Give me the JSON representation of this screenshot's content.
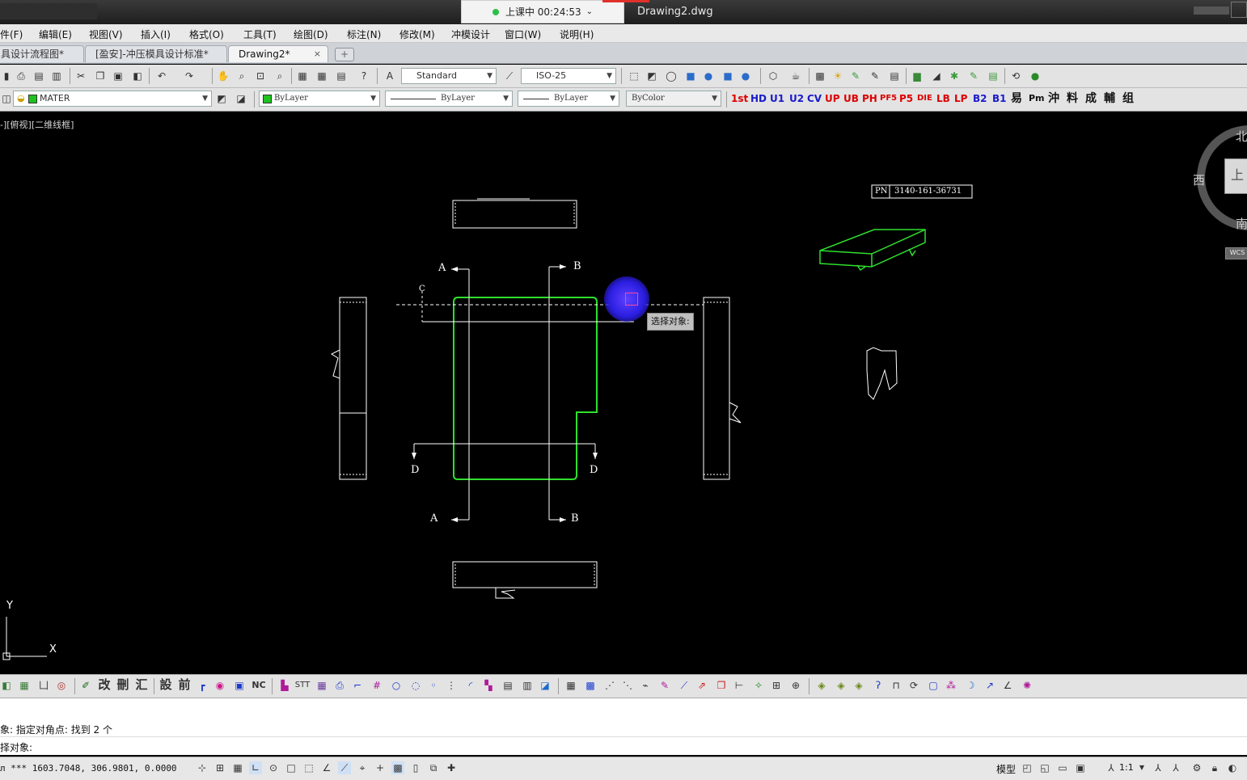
{
  "window": {
    "live_status": "上课中 00:24:53",
    "document_title": "Drawing2.dwg"
  },
  "menu": [
    "件(F)",
    "编辑(E)",
    "视图(V)",
    "插入(I)",
    "格式(O)",
    "工具(T)",
    "绘图(D)",
    "标注(N)",
    "修改(M)",
    "冲模设计",
    "窗口(W)",
    "说明(H)"
  ],
  "tabs": [
    {
      "label": "具设计流程图*"
    },
    {
      "label": "[盈安]-冲压模具设计标准*"
    },
    {
      "label": "Drawing2*",
      "close": "×"
    }
  ],
  "toolbar": {
    "text_style": "Standard",
    "dim_style": "ISO-25",
    "layer": "MATER",
    "color": "ByLayer",
    "linetype": "ByLayer",
    "lineweight": "ByLayer",
    "plot_style": "ByColor",
    "custom_tools": [
      "1st",
      "HD",
      "U1",
      "U2",
      "CV",
      "UP",
      "UB",
      "PH",
      "PF5",
      "P5",
      "DIE",
      "LB",
      "LP",
      "B2",
      "B1",
      "易",
      "Pm",
      "沖",
      "料",
      "成",
      "輔",
      "组"
    ],
    "bottom_text_tools": [
      "改",
      "刪",
      "汇",
      "設",
      "前",
      "NC",
      "STT"
    ]
  },
  "viewport": {
    "label": "-][俯视][二维线框]",
    "viewcube": {
      "north": "北",
      "west": "西",
      "south": "南",
      "top": "上",
      "wcs": "WCS"
    },
    "tooltip": "选择对象:",
    "part_number_label": "PN",
    "part_number": "3140-161-36731",
    "section_labels": {
      "a": "A",
      "b": "B",
      "c": "C",
      "d": "D"
    },
    "ucs_x": "X",
    "ucs_y": "Y"
  },
  "command": {
    "history": "象: 指定对角点: 找到 2 个",
    "prompt": "择对象:"
  },
  "status": {
    "coordinates": "1603.7048,  306.9801,  0.0000",
    "model": "模型",
    "scale": "1:1"
  }
}
